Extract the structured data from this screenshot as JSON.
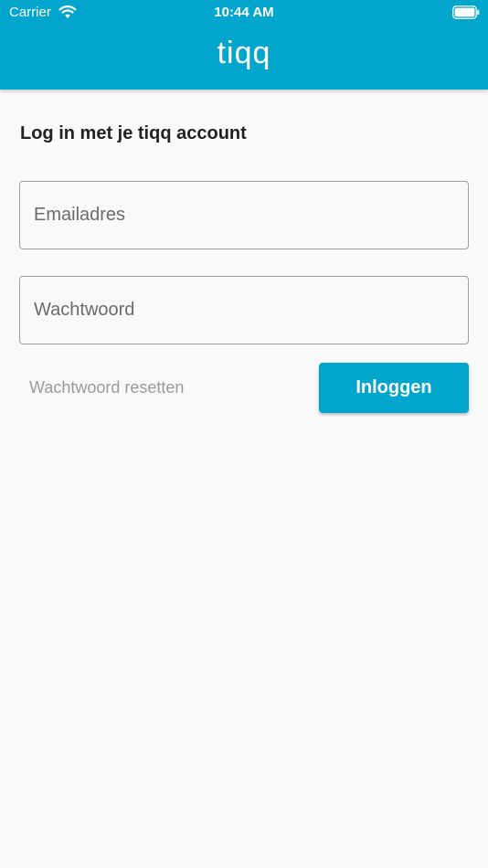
{
  "status_bar": {
    "carrier": "Carrier",
    "time": "10:44 AM",
    "icons": [
      "wifi-icon",
      "battery-icon"
    ]
  },
  "app_bar": {
    "logo": "tiqq"
  },
  "login": {
    "title": "Log in met je tiqq account",
    "email_placeholder": "Emailadres",
    "email_value": "",
    "password_placeholder": "Wachtwoord",
    "password_value": "",
    "reset_label": "Wachtwoord resetten",
    "login_label": "Inloggen"
  },
  "colors": {
    "brand": "#02a6cd",
    "background": "#f9f9f9",
    "title_text": "#222222",
    "muted_text": "#9a9a9a",
    "field_border": "#9e9e9e"
  }
}
